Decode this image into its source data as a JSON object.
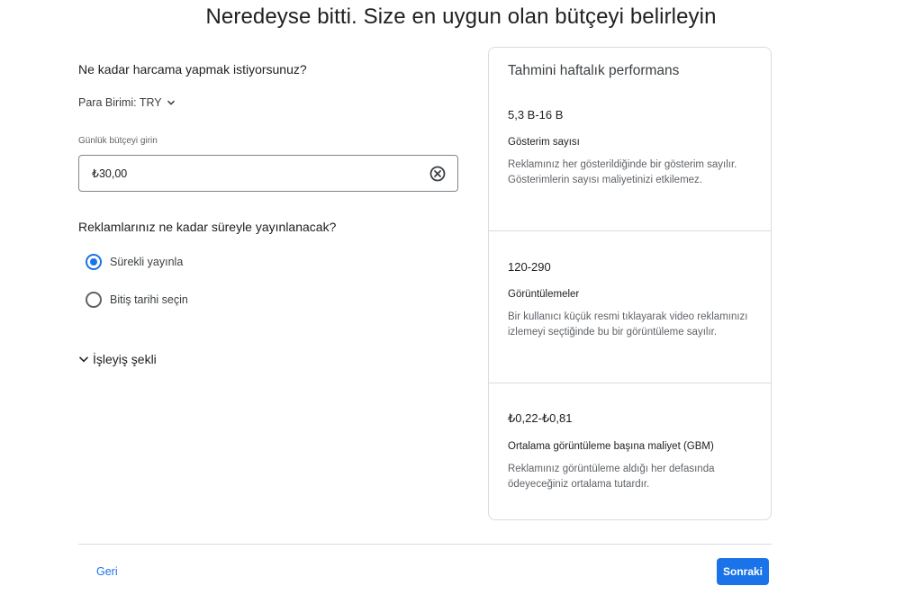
{
  "page": {
    "title": "Neredeyse bitti. Size en uygun olan bütçeyi belirleyin"
  },
  "budget": {
    "question": "Ne kadar harcama yapmak istiyorsunuz?",
    "currency_label": "Para Birimi: TRY",
    "field_caption": "Günlük bütçeyi girin",
    "value": "₺30,00"
  },
  "duration": {
    "question": "Reklamlarınız ne kadar süreyle yayınlanacak?",
    "options": [
      {
        "label": "Sürekli yayınla",
        "selected": true
      },
      {
        "label": "Bitiş tarihi seçin",
        "selected": false
      }
    ]
  },
  "how_it_works": {
    "label": "İşleyiş şekli"
  },
  "performance": {
    "title": "Tahmini haftalık performans",
    "metrics": [
      {
        "value": "5,3 B-16 B",
        "name": "Gösterim sayısı",
        "description": "Reklamınız her gösterildiğinde bir gösterim sayılır. Gösterimlerin sayısı maliyetinizi etkilemez."
      },
      {
        "value": "120-290",
        "name": "Görüntülemeler",
        "description": "Bir kullanıcı küçük resmi tıklayarak video reklamınızı izlemeyi seçtiğinde bu bir görüntüleme sayılır."
      },
      {
        "value": "₺0,22-₺0,81",
        "name": "Ortalama görüntüleme başına maliyet (GBM)",
        "description": "Reklamınız görüntüleme aldığı her defasında ödeyeceğiniz ortalama tutardır."
      }
    ]
  },
  "footer": {
    "back_label": "Geri",
    "next_label": "Sonraki"
  },
  "colors": {
    "accent": "#1a73e8",
    "border": "#dadce0",
    "text": "#202124",
    "muted": "#5f6368"
  },
  "icons": {
    "currency_dropdown": "chevron-down-icon",
    "clear": "clear-circle-icon",
    "expander": "chevron-down-icon"
  }
}
